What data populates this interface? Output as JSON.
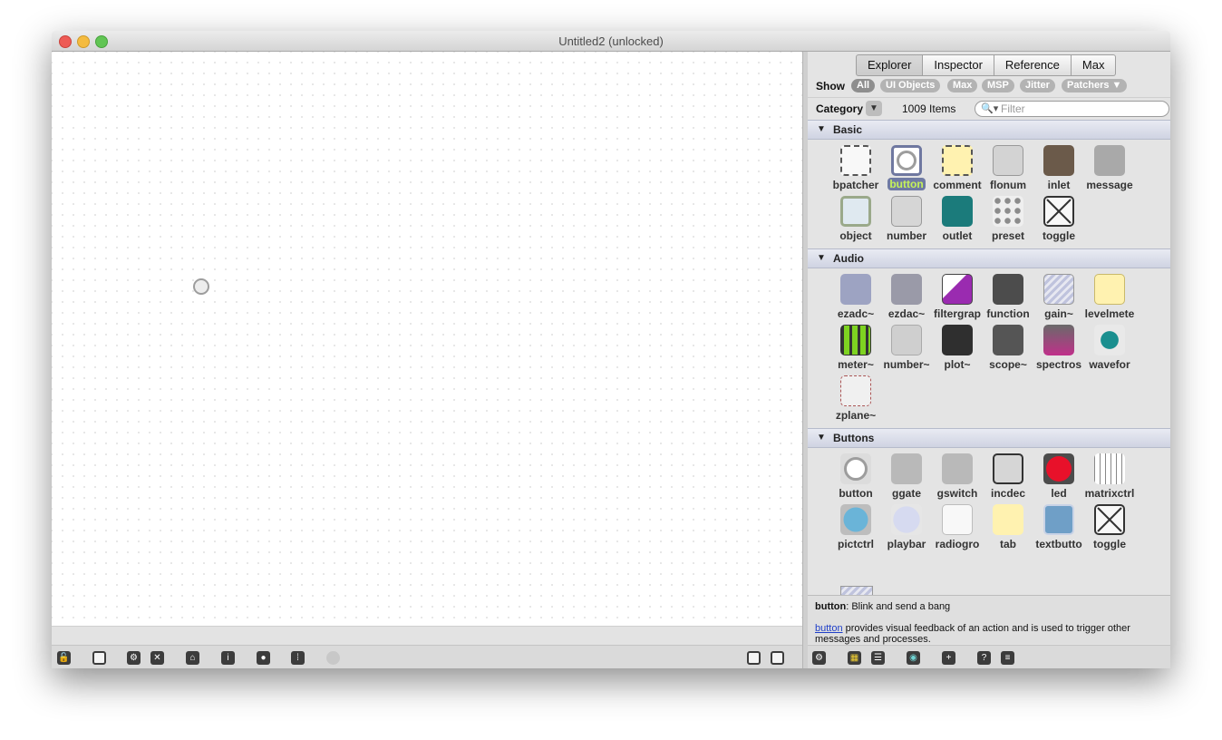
{
  "window": {
    "title": "Untitled2 (unlocked)"
  },
  "sidebar": {
    "tabs": [
      "Explorer",
      "Inspector",
      "Reference",
      "Max"
    ],
    "show_label": "Show",
    "filters": [
      "All",
      "UI Objects",
      "Max",
      "MSP",
      "Jitter",
      "Patchers ▼"
    ],
    "category_label": "Category",
    "item_count": "1009 Items",
    "filter_placeholder": "Filter",
    "sections": [
      {
        "title": "Basic",
        "items": [
          "bpatcher",
          "button",
          "comment",
          "flonum",
          "inlet",
          "message",
          "object",
          "number",
          "outlet",
          "preset",
          "toggle"
        ]
      },
      {
        "title": "Audio",
        "items": [
          "ezadc~",
          "ezdac~",
          "filtergrap",
          "function",
          "gain~",
          "levelmete",
          "meter~",
          "number~",
          "plot~",
          "scope~",
          "spectros",
          "wavefor",
          "zplane~"
        ]
      },
      {
        "title": "Buttons",
        "items": [
          "button",
          "ggate",
          "gswitch",
          "incdec",
          "led",
          "matrixctrl",
          "pictctrl",
          "playbar",
          "radiogro",
          "tab",
          "textbutto",
          "toggle"
        ]
      }
    ],
    "selected_item": "button",
    "preview": {
      "name": "button",
      "summary": ": Blink and send a bang",
      "link": "button",
      "description": " provides visual feedback of an action and is used to trigger other messages and processes."
    }
  },
  "colors": {
    "selection": "#6f7aa3",
    "selection_text": "#c5f25a",
    "section_header": "#cfd3e2"
  }
}
